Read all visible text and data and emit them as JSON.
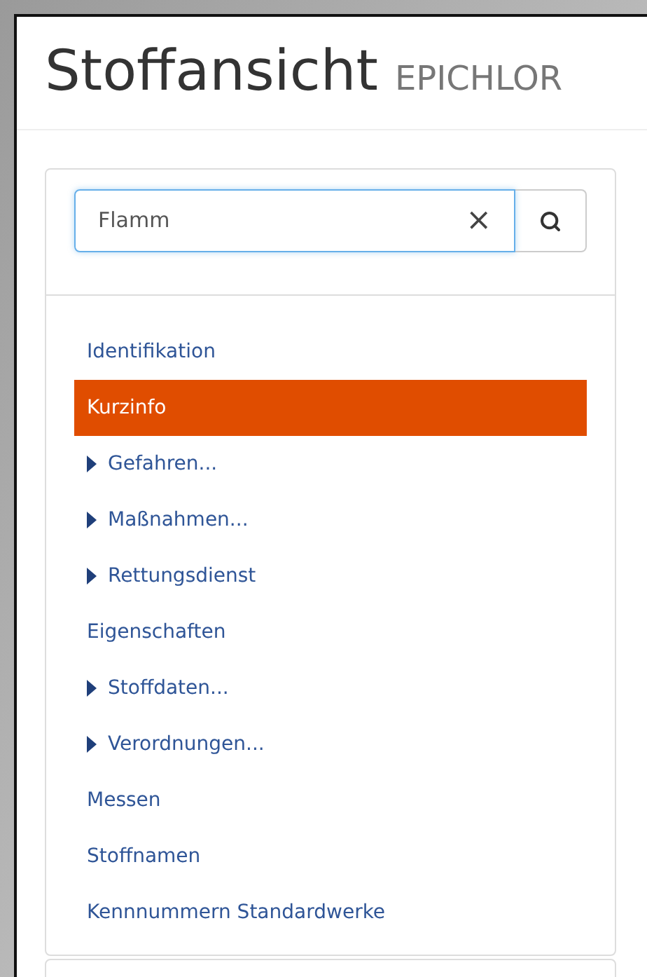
{
  "heading": {
    "title": "Stoffansicht",
    "subtitle": "EPICHLOR"
  },
  "search": {
    "value": "Flamm",
    "clear": "×"
  },
  "nav": [
    {
      "label": "Identifikation",
      "kind": "link",
      "selected": false
    },
    {
      "label": "Kurzinfo",
      "kind": "link",
      "selected": true
    },
    {
      "label": "Gefahren...",
      "kind": "group",
      "selected": false
    },
    {
      "label": "Maßnahmen...",
      "kind": "group",
      "selected": false
    },
    {
      "label": "Rettungsdienst",
      "kind": "group",
      "selected": false
    },
    {
      "label": "Eigenschaften",
      "kind": "link",
      "selected": false
    },
    {
      "label": "Stoffdaten...",
      "kind": "group",
      "selected": false
    },
    {
      "label": "Verordnungen...",
      "kind": "group",
      "selected": false
    },
    {
      "label": "Messen",
      "kind": "link",
      "selected": false
    },
    {
      "label": "Stoffnamen",
      "kind": "link",
      "selected": false
    },
    {
      "label": "Kennnummern Standardwerke",
      "kind": "link",
      "selected": false
    }
  ]
}
